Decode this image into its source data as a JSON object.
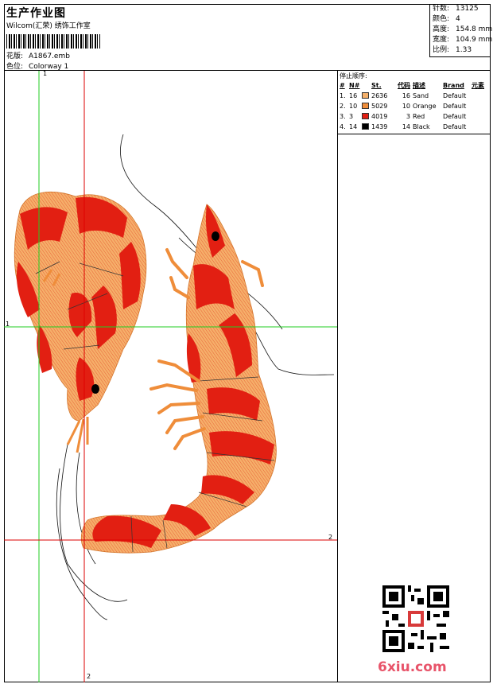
{
  "header": {
    "title": "生产作业图",
    "subtitle": "Wilcom(汇荣) 绣饰工作室",
    "design_label": "花版:",
    "design_value": "A1867.emb",
    "colorway_label": "色位:",
    "colorway_value": "Colorway 1"
  },
  "stats": [
    {
      "label": "针数:",
      "value": "13125"
    },
    {
      "label": "颜色:",
      "value": "4"
    },
    {
      "label": "高度:",
      "value": "154.8 mm"
    },
    {
      "label": "宽度:",
      "value": "104.9 mm"
    },
    {
      "label": "比例:",
      "value": "1.33"
    }
  ],
  "stop_sequence": {
    "title": "停止顺序:",
    "headers": [
      "#",
      "N#",
      "St.",
      "代码",
      "描述",
      "Brand",
      "元素"
    ],
    "rows": [
      {
        "idx": "1.",
        "n": "16",
        "st": "2636",
        "code": "16",
        "desc": "Sand",
        "brand": "Default",
        "color": "#f5b06a"
      },
      {
        "idx": "2.",
        "n": "10",
        "st": "5029",
        "code": "10",
        "desc": "Orange",
        "brand": "Default",
        "color": "#ef8d3a"
      },
      {
        "idx": "3.",
        "n": "3",
        "st": "4019",
        "code": "3",
        "desc": "Red",
        "brand": "Default",
        "color": "#e21f12"
      },
      {
        "idx": "4.",
        "n": "14",
        "st": "1439",
        "code": "14",
        "desc": "Black",
        "brand": "Default",
        "color": "#000000"
      }
    ]
  },
  "axes": {
    "top_1": "1",
    "left_1": "1",
    "right_2": "2",
    "bottom_2": "2"
  },
  "logo_text": "6xiu.com",
  "colors": {
    "green_guide": "#22cc22",
    "red_guide": "#dd0000",
    "sand": "#f5b06a",
    "orange": "#ef8d3a",
    "red": "#e21f12"
  }
}
